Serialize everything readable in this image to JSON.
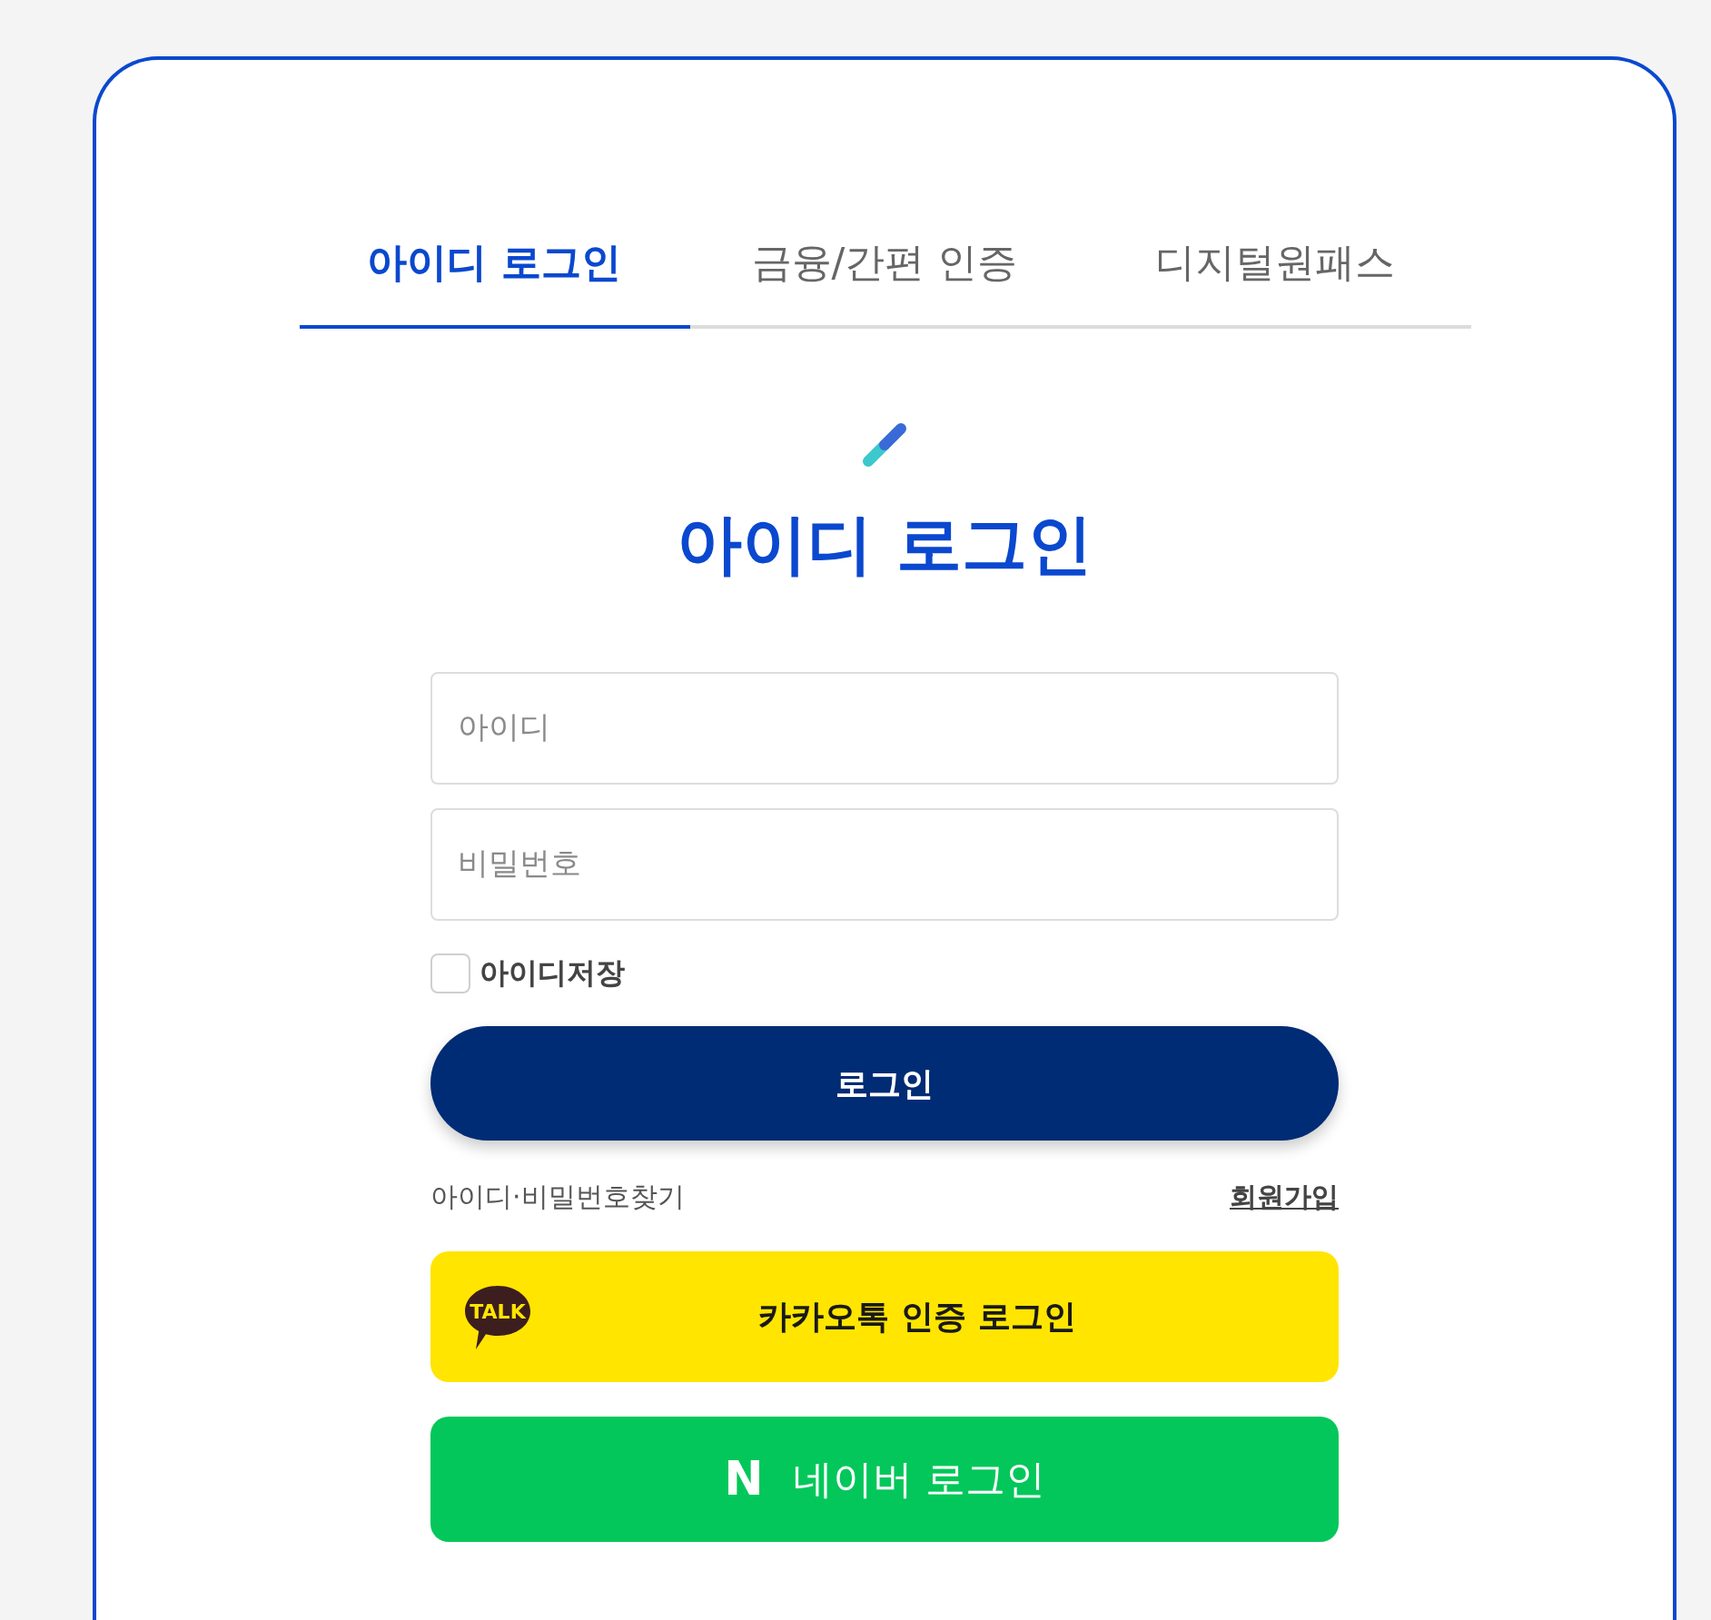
{
  "tabs": [
    {
      "label": "아이디 로그인",
      "selected": true
    },
    {
      "label": "금융/간편 인증",
      "selected": false
    },
    {
      "label": "디지털원패스",
      "selected": false
    }
  ],
  "heading": "아이디 로그인",
  "fields": [
    {
      "placeholder": "아이디"
    },
    {
      "placeholder": "비밀번호"
    }
  ],
  "remember_id": {
    "label": "아이디저장",
    "checked": false
  },
  "login_button": "로그인",
  "links": {
    "find_account": "아이디·비밀번호찾기",
    "sign_up": "회원가입"
  },
  "social_logins": [
    {
      "kind": "kakao",
      "logo_text": "TALK",
      "label": "카카오톡 인증 로그인"
    },
    {
      "kind": "naver",
      "logo_text": "N",
      "label": "네이버 로그인"
    }
  ]
}
